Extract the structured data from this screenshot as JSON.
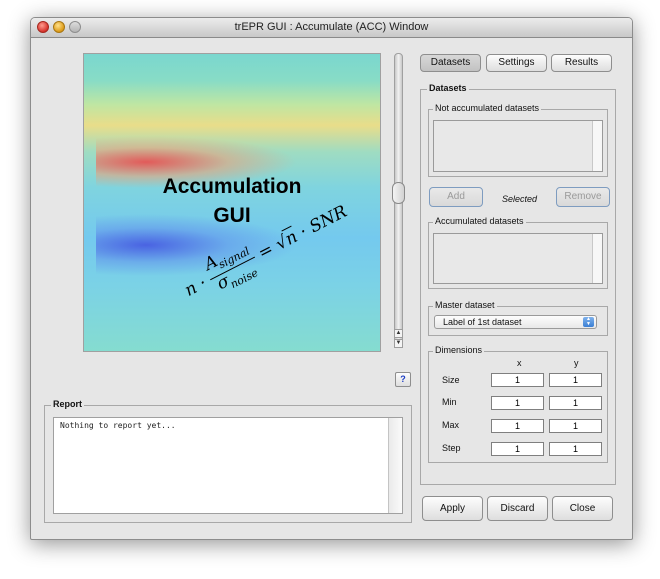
{
  "window": {
    "title": "trEPR GUI : Accumulate (ACC) Window"
  },
  "image": {
    "heading_line1": "Accumulation",
    "heading_line2": "GUI",
    "formula": "n · A_signal / σ_noise = √n · SNR"
  },
  "help_label": "?",
  "report": {
    "title": "Report",
    "text": "Nothing to report yet..."
  },
  "tabs": {
    "datasets": "Datasets",
    "settings": "Settings",
    "results": "Results"
  },
  "datasets_panel": {
    "title": "Datasets",
    "not_accumulated_title": "Not accumulated datasets",
    "add_label": "Add",
    "selected_label": "Selected",
    "remove_label": "Remove",
    "accumulated_title": "Accumulated datasets"
  },
  "master": {
    "title": "Master dataset",
    "selected": "Label of 1st dataset"
  },
  "dimensions": {
    "title": "Dimensions",
    "col_x": "x",
    "col_y": "y",
    "rows": [
      {
        "label": "Size",
        "x": "1",
        "y": "1"
      },
      {
        "label": "Min",
        "x": "1",
        "y": "1"
      },
      {
        "label": "Max",
        "x": "1",
        "y": "1"
      },
      {
        "label": "Step",
        "x": "1",
        "y": "1"
      }
    ]
  },
  "buttons": {
    "apply": "Apply",
    "discard": "Discard",
    "close": "Close"
  }
}
